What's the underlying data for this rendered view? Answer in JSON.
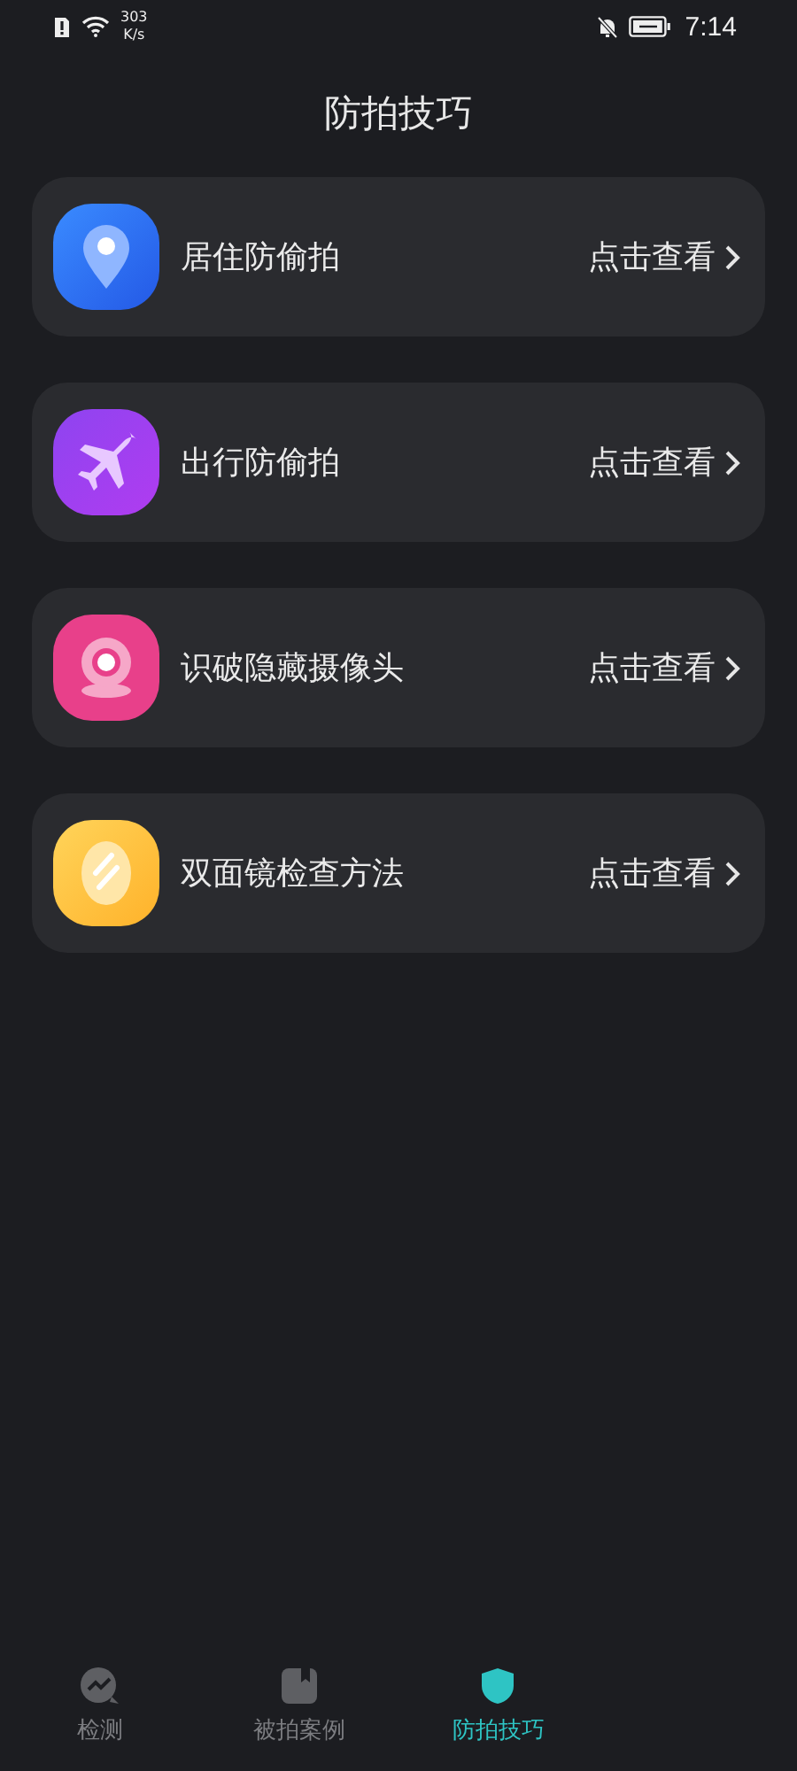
{
  "status_bar": {
    "speed_value": "303",
    "speed_unit": "K/s",
    "time": "7:14"
  },
  "title": "防拍技巧",
  "tips": [
    {
      "kind": "location",
      "title": "居住防偷拍",
      "action": "点击查看"
    },
    {
      "kind": "plane",
      "title": "出行防偷拍",
      "action": "点击查看"
    },
    {
      "kind": "camera",
      "title": "识破隐藏摄像头",
      "action": "点击查看"
    },
    {
      "kind": "mirror",
      "title": "双面镜检查方法",
      "action": "点击查看"
    }
  ],
  "tab_bar": [
    {
      "kind": "detect",
      "label": "检测",
      "selected": false
    },
    {
      "kind": "cases",
      "label": "被拍案例",
      "selected": false
    },
    {
      "kind": "tips",
      "label": "防拍技巧",
      "selected": true
    }
  ]
}
